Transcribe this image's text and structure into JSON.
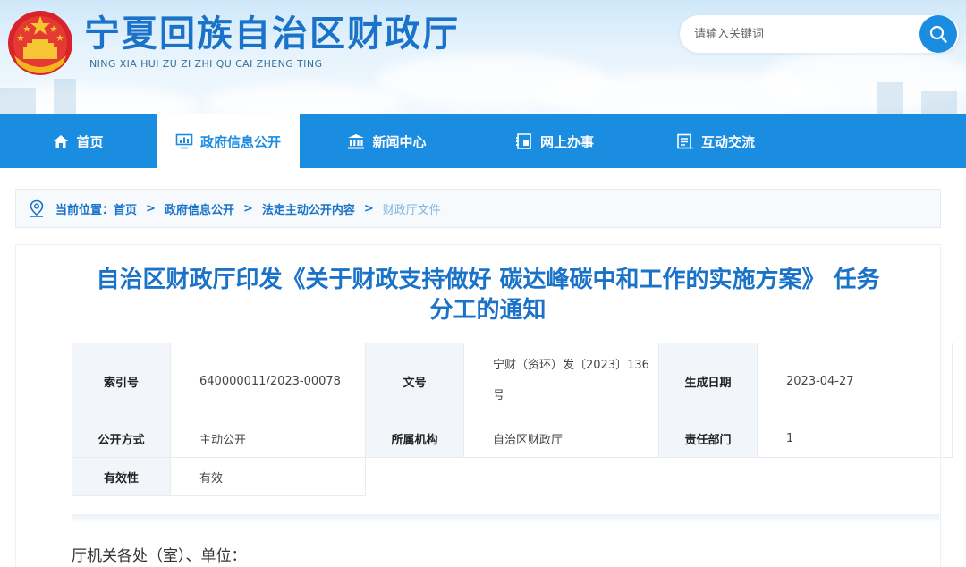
{
  "header": {
    "title_cn": "宁夏回族自治区财政厅",
    "title_en": "NING XIA HUI ZU ZI ZHI QU CAI ZHENG TING",
    "search_placeholder": "请输入关键词"
  },
  "nav": {
    "items": [
      {
        "label": "首页",
        "icon": "home-icon"
      },
      {
        "label": "政府信息公开",
        "icon": "chart-monitor-icon",
        "active": true
      },
      {
        "label": "新闻中心",
        "icon": "building-icon"
      },
      {
        "label": "网上办事",
        "icon": "document-icon"
      },
      {
        "label": "互动交流",
        "icon": "form-icon"
      }
    ]
  },
  "breadcrumb": {
    "prefix": "当前位置：",
    "items": [
      "首页",
      "政府信息公开",
      "法定主动公开内容",
      "财政厅文件"
    ],
    "separator": ">"
  },
  "article": {
    "title_line1": "自治区财政厅印发《关于财政支持做好 碳达峰碳中和工作的实施方案》 任务",
    "title_line2": "分工的通知",
    "meta": {
      "index_label": "索引号",
      "index_value": "640000011/2023-00078",
      "doc_no_label": "文号",
      "doc_no_value_1": "宁财（资环）发〔2023〕136",
      "doc_no_value_2": "号",
      "date_label": "生成日期",
      "date_value": "2023-04-27",
      "open_label": "公开方式",
      "open_value": "主动公开",
      "org_label": "所属机构",
      "org_value": "自治区财政厅",
      "dept_label": "责任部门",
      "dept_value": "1",
      "valid_label": "有效性",
      "valid_value": "有效"
    },
    "body_first_line": "厅机关各处（室）、单位："
  },
  "colors": {
    "primary": "#1b8de0",
    "title": "#1a73c8"
  }
}
